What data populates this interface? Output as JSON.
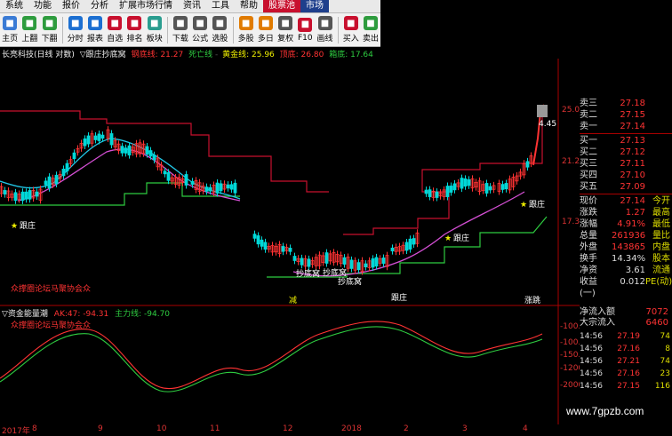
{
  "menu": [
    "系统",
    "功能",
    "报价",
    "分析",
    "扩展市场行情",
    "资讯",
    "工具",
    "帮助",
    "股票池",
    "市场"
  ],
  "toolbar": [
    {
      "label": "主页",
      "icon": "home-icon",
      "color": "#3a7bd5"
    },
    {
      "label": "上翻",
      "icon": "page-up-icon",
      "color": "#2e9c3e"
    },
    {
      "label": "下翻",
      "icon": "page-down-icon",
      "color": "#2e9c3e"
    },
    {
      "label": "分时",
      "icon": "intraday-icon",
      "color": "#1c6fd1"
    },
    {
      "label": "报表",
      "icon": "report-icon",
      "color": "#1c6fd1"
    },
    {
      "label": "自选",
      "icon": "watchlist-icon",
      "color": "#c8102e"
    },
    {
      "label": "排名",
      "icon": "ranking-icon",
      "color": "#c8102e"
    },
    {
      "label": "板块",
      "icon": "sector-icon",
      "color": "#2a9d8f"
    },
    {
      "label": "下载",
      "icon": "download-icon",
      "color": "#555"
    },
    {
      "label": "公式",
      "icon": "formula-icon",
      "color": "#555"
    },
    {
      "label": "选股",
      "icon": "stock-picker-icon",
      "color": "#555"
    },
    {
      "label": "多股",
      "icon": "multi-stock-icon",
      "color": "#e07b00"
    },
    {
      "label": "多日",
      "icon": "multi-day-icon",
      "color": "#e07b00"
    },
    {
      "label": "复权",
      "icon": "adjust-icon",
      "color": "#555"
    },
    {
      "label": "F10",
      "icon": "f10-icon",
      "color": "#c8102e"
    },
    {
      "label": "画线",
      "icon": "draw-line-icon",
      "color": "#555"
    },
    {
      "label": "买入",
      "icon": "buy-icon",
      "color": "#c8102e"
    },
    {
      "label": "卖出",
      "icon": "sell-icon",
      "color": "#2e9c3e"
    }
  ],
  "chart_title": {
    "stock": "长亮科技(日线 对数)",
    "indicator": "▽跟庄抄底窝",
    "line1_label": "钢底线: 21.27",
    "line2_label": "死亡线",
    "line3_label": "黄金线: 25.96",
    "line4_label": "顶底: 26.80",
    "line5_label": "箱底: 17.64"
  },
  "price_axis": [
    "25.04",
    "21.22",
    "17.39"
  ],
  "chart_labels": {
    "genzhuang": "跟庄",
    "chaodiwo": "抄底窝",
    "fomo": "众撑圈论坛马聚协会众",
    "jian": "减",
    "zhengchao": "跟庄",
    "price_tag": "4.45",
    "right_tag": "涨跳"
  },
  "sub_chart": {
    "title": "▽资金能量潮",
    "ak_label": "AK:47: -94.31",
    "zl_label": "主力线: -94.70",
    "axis": [
      "-100.00",
      "-100.00",
      "-150.00",
      "-1200.0",
      "-2000.0"
    ]
  },
  "quote": {
    "asks": [
      {
        "k": "卖三",
        "v": "27.18"
      },
      {
        "k": "卖二",
        "v": "27.15"
      },
      {
        "k": "卖一",
        "v": "27.14"
      }
    ],
    "bids": [
      {
        "k": "买一",
        "v": "27.13"
      },
      {
        "k": "买二",
        "v": "27.12"
      },
      {
        "k": "买三",
        "v": "27.11"
      },
      {
        "k": "买四",
        "v": "27.10"
      },
      {
        "k": "买五",
        "v": "27.09"
      }
    ],
    "stats": [
      {
        "k": "现价",
        "v": "27.14",
        "n": "今开"
      },
      {
        "k": "涨跌",
        "v": "1.27",
        "n": "最高"
      },
      {
        "k": "涨幅",
        "v": "4.91%",
        "n": "最低"
      },
      {
        "k": "总量",
        "v": "261936",
        "n": "量比"
      },
      {
        "k": "外盘",
        "v": "143865",
        "n": "内盘"
      },
      {
        "k": "换手",
        "v": "14.34%",
        "n": "股本"
      },
      {
        "k": "净资",
        "v": "3.61",
        "n": "流通"
      },
      {
        "k": "收益(一)",
        "v": "0.012",
        "n": "PE(动)"
      }
    ]
  },
  "fund_flow": [
    {
      "k": "净流入额",
      "v": "7072"
    },
    {
      "k": "大宗流入",
      "v": "6460"
    }
  ],
  "ticks": [
    {
      "t": "14:56",
      "p": "27.19",
      "q": "74"
    },
    {
      "t": "14:56",
      "p": "27.16",
      "q": "8"
    },
    {
      "t": "14:56",
      "p": "27.21",
      "q": "74"
    },
    {
      "t": "14:56",
      "p": "27.16",
      "q": "23"
    },
    {
      "t": "14:56",
      "p": "27.15",
      "q": "116"
    }
  ],
  "dates": [
    "2017年",
    "8",
    "9",
    "10",
    "11",
    "12",
    "2018",
    "2",
    "3",
    "4"
  ],
  "watermark": "www.7gpzb.com",
  "colors": {
    "up": "#ff3333",
    "down": "#00d8d8",
    "resistance": "#c8102e",
    "support": "#2ecc40",
    "ma_magenta": "#d44fd4",
    "ma_cyan": "#22c6e6"
  }
}
